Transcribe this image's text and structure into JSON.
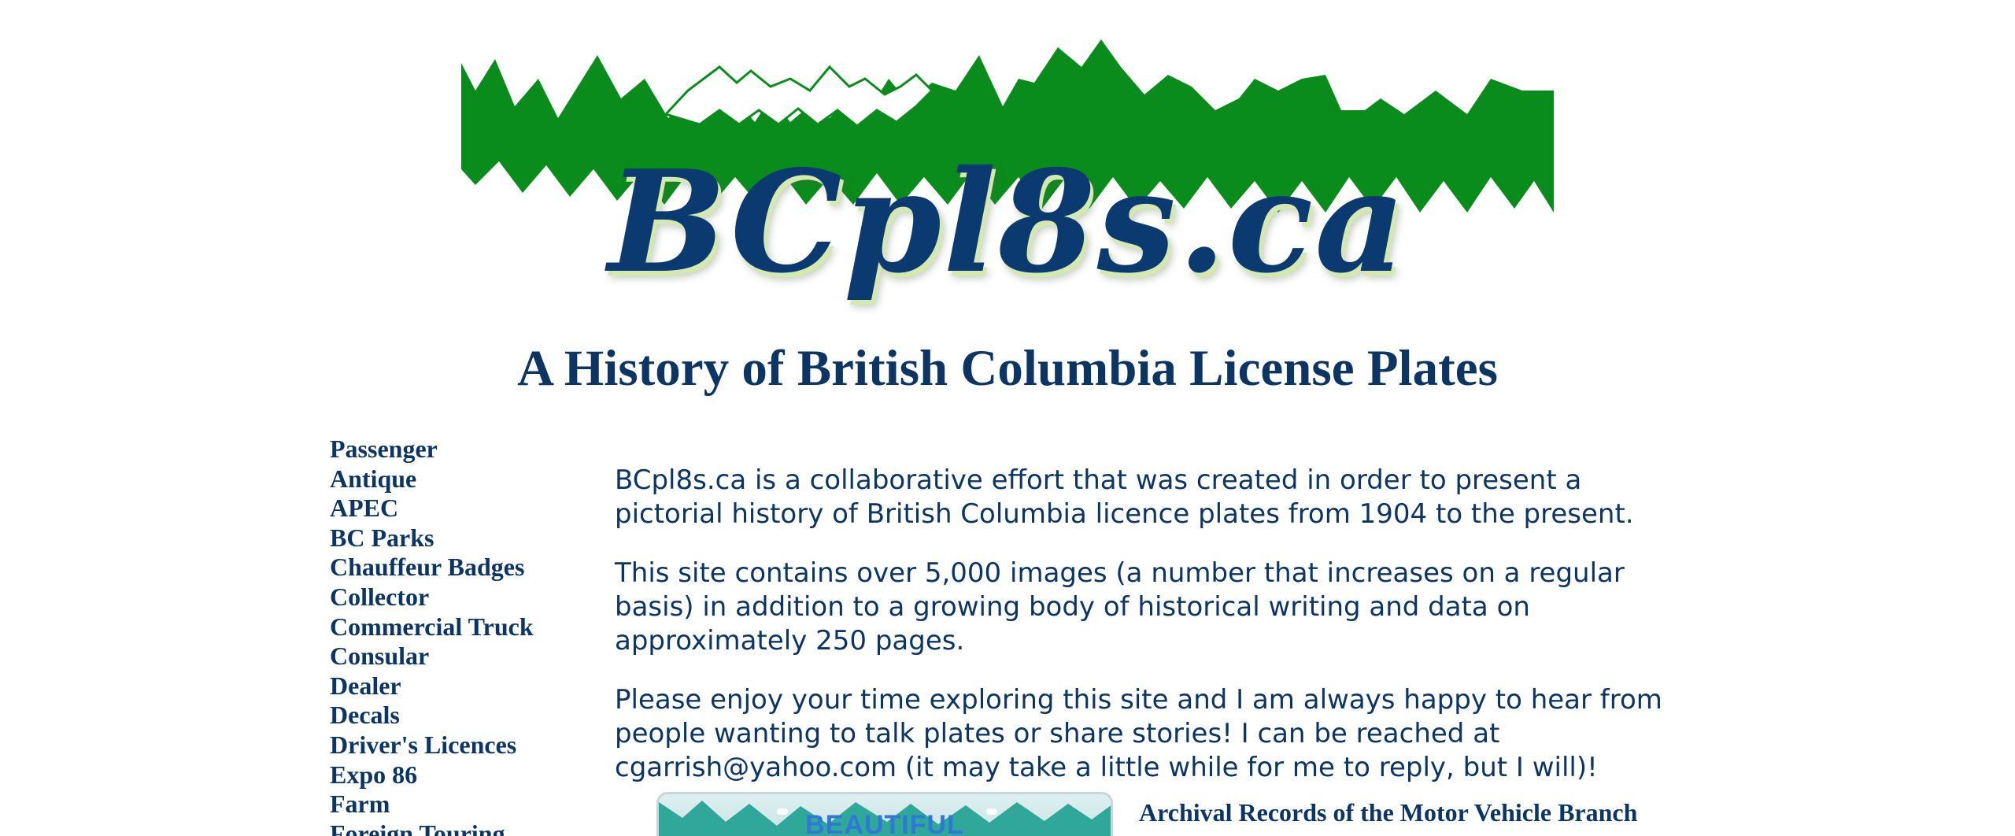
{
  "logo": {
    "text": "BCpl8s.ca",
    "colors": {
      "mountains": "#0a8c1c",
      "outline": "#0a8c1c",
      "text": "#0b3a70",
      "shadow": "#d4e9b0"
    }
  },
  "header": {
    "title": "A History of British Columbia License Plates"
  },
  "sidebar": {
    "items": [
      {
        "label": "Passenger"
      },
      {
        "label": "Antique"
      },
      {
        "label": "APEC"
      },
      {
        "label": "BC Parks"
      },
      {
        "label": "Chauffeur Badges"
      },
      {
        "label": "Collector"
      },
      {
        "label": "Commercial Truck"
      },
      {
        "label": "Consular"
      },
      {
        "label": "Dealer"
      },
      {
        "label": "Decals"
      },
      {
        "label": "Driver's Licences"
      },
      {
        "label": "Expo 86"
      },
      {
        "label": "Farm"
      },
      {
        "label": "Foreign Touring"
      }
    ]
  },
  "intro": {
    "paragraphs": [
      "BCpl8s.ca is a collaborative effort that was created in order to present a pictorial history of British Columbia licence plates from 1904 to the present.",
      "This site contains over 5,000 images (a number that increases on a regular basis) in addition to a growing body of historical writing and data on approximately 250 pages.",
      "Please enjoy your time exploring this site and I am always happy to hear from people wanting to talk plates or share stories! I can be reached at cgarrish@yahoo.com (it may take a little while for me to reply, but I will)!"
    ]
  },
  "plate": {
    "slogan": "BEAUTIFUL",
    "colors": {
      "mountains": "#2fa89a",
      "slogan": "#2f78d6"
    }
  },
  "archival": {
    "label": "Archival Records of the Motor Vehicle Branch"
  },
  "colors": {
    "text": "#0c3564",
    "background": "#ffffff"
  }
}
